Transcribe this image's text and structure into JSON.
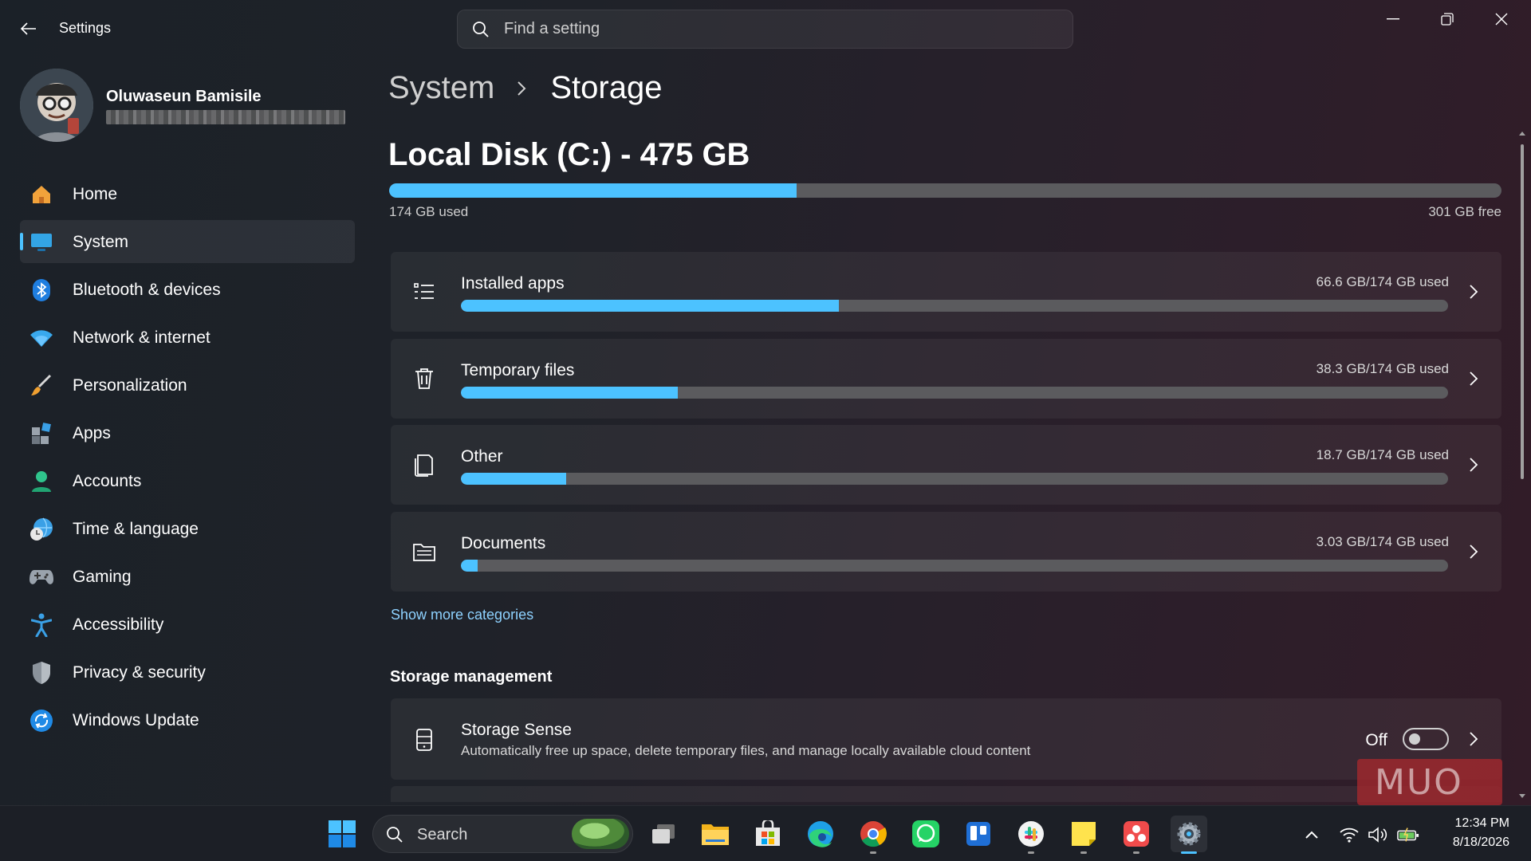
{
  "window": {
    "title": "Settings",
    "search_placeholder": "Find a setting"
  },
  "user": {
    "name": "Oluwaseun Bamisile"
  },
  "sidebar": {
    "items": [
      {
        "label": "Home",
        "icon": "home-icon"
      },
      {
        "label": "System",
        "icon": "system-icon",
        "active": true
      },
      {
        "label": "Bluetooth & devices",
        "icon": "bluetooth-icon"
      },
      {
        "label": "Network & internet",
        "icon": "wifi-icon"
      },
      {
        "label": "Personalization",
        "icon": "brush-icon"
      },
      {
        "label": "Apps",
        "icon": "apps-icon"
      },
      {
        "label": "Accounts",
        "icon": "person-icon"
      },
      {
        "label": "Time & language",
        "icon": "globe-clock-icon"
      },
      {
        "label": "Gaming",
        "icon": "gamepad-icon"
      },
      {
        "label": "Accessibility",
        "icon": "accessibility-icon"
      },
      {
        "label": "Privacy & security",
        "icon": "shield-icon"
      },
      {
        "label": "Windows Update",
        "icon": "update-icon"
      }
    ]
  },
  "breadcrumb": {
    "parent": "System",
    "current": "Storage"
  },
  "disk": {
    "title": "Local Disk (C:) - 475 GB",
    "used_label": "174 GB used",
    "free_label": "301 GB free",
    "used_fraction": 0.366
  },
  "categories": [
    {
      "name": "Installed apps",
      "usage": "66.6 GB/174 GB used",
      "fraction": 0.383,
      "icon": "list-icon"
    },
    {
      "name": "Temporary files",
      "usage": "38.3 GB/174 GB used",
      "fraction": 0.22,
      "icon": "trash-icon"
    },
    {
      "name": "Other",
      "usage": "18.7 GB/174 GB used",
      "fraction": 0.107,
      "icon": "other-files-icon"
    },
    {
      "name": "Documents",
      "usage": "3.03 GB/174 GB used",
      "fraction": 0.017,
      "icon": "folder-icon"
    }
  ],
  "show_more": "Show more categories",
  "storage_management": {
    "heading": "Storage management",
    "sense_title": "Storage Sense",
    "sense_desc": "Automatically free up space, delete temporary files, and manage locally available cloud content",
    "toggle_label": "Off"
  },
  "watermark": "MUO",
  "taskbar": {
    "search_label": "Search",
    "time": "12:34 PM",
    "date": "8/18/2026"
  },
  "colors": {
    "accent": "#4cc2ff",
    "bar_track": "#5b5b5e",
    "link": "#8ed2ff"
  }
}
